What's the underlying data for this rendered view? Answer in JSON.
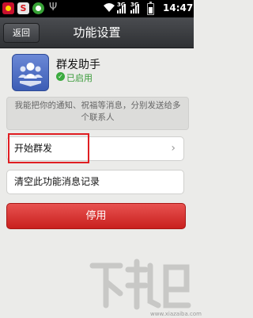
{
  "status_bar": {
    "time": "14:47",
    "net_label_1": "3G",
    "net_label_2": "3G"
  },
  "header": {
    "back_label": "返回",
    "title": "功能设置"
  },
  "plugin": {
    "name": "群发助手",
    "status": "已启用",
    "status_color": "#3a9b3a",
    "description": "我能把你的通知、祝福等消息，分别发送给多个联系人"
  },
  "actions": {
    "start_label": "开始群发",
    "clear_label": "清空此功能消息记录",
    "disable_label": "停用"
  },
  "colors": {
    "accent_red": "#d42f2d",
    "highlight_red": "#e01e22",
    "plugin_blue": "#4a6cc8"
  },
  "watermark": {
    "url": "www.xiazaiba.com"
  }
}
